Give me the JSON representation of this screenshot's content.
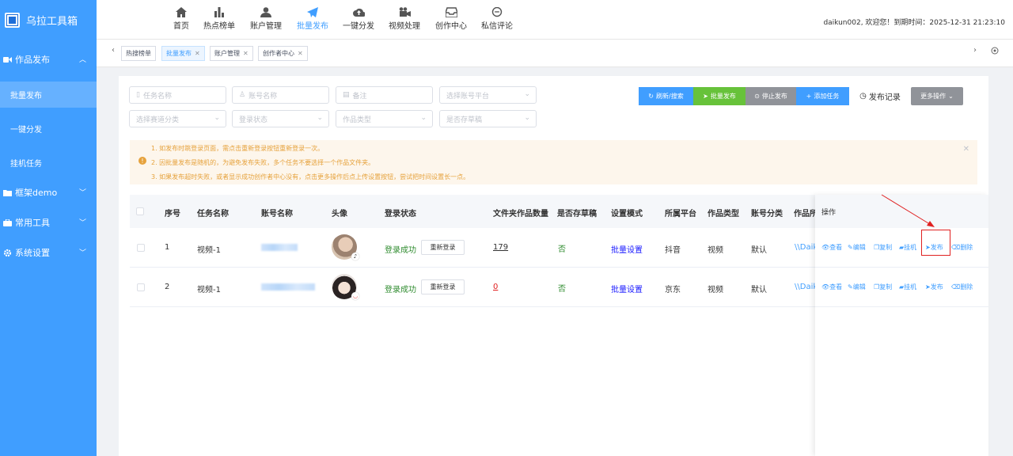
{
  "app": {
    "title": "乌拉工具箱"
  },
  "sidebar": {
    "groups": [
      {
        "label": "作品发布",
        "icon": "video-camera-icon"
      },
      {
        "label": "框架demo",
        "icon": "folder-icon"
      },
      {
        "label": "常用工具",
        "icon": "briefcase-icon"
      },
      {
        "label": "系统设置",
        "icon": "gear-icon"
      }
    ],
    "subitems": [
      "批量发布",
      "一键分发",
      "挂机任务"
    ]
  },
  "topnav": {
    "items": [
      "首页",
      "热点榜单",
      "账户管理",
      "批量发布",
      "一键分发",
      "视频处理",
      "创作中心",
      "私信评论"
    ],
    "active": "批量发布",
    "user_info": "daikun002, 欢迎您！到期时间：2025-12-31 21:23:10"
  },
  "tabs": [
    {
      "label": "热搜榜单"
    },
    {
      "label": "批量发布"
    },
    {
      "label": "账户管理"
    },
    {
      "label": "创作者中心"
    }
  ],
  "filters": {
    "task_name": "任务名称",
    "account_name": "账号名称",
    "remark": "备注",
    "platform": "选择账号平台",
    "category": "选择赛道分类",
    "login_status": "登录状态",
    "work_type": "作品类型",
    "draft": "是否存草稿"
  },
  "toolbar": {
    "refresh": "刷新/搜索",
    "batch_publish": "批量发布",
    "stop_publish": "停止发布",
    "add_task": "添加任务",
    "publish_log": "发布记录",
    "more": "更多操作"
  },
  "alert": {
    "lines": [
      "1. 如发布时跳登录页面，需点击重新登录按钮重新登录一次。",
      "2. 因批量发布是随机的，为避免发布失败，多个任务不要选择一个作品文件夹。",
      "3. 如果发布超时失败，或者显示成功创作者中心没有，点击更多操作后点上传设置按钮，尝试把时间设置长一点。"
    ]
  },
  "table": {
    "headers": [
      "序号",
      "任务名称",
      "账号名称",
      "头像",
      "登录状态",
      "文件夹作品数量",
      "是否存草稿",
      "设置模式",
      "所属平台",
      "作品类型",
      "账号分类",
      "作品所",
      "操作"
    ],
    "relogin_label": "重新登录",
    "rows": [
      {
        "index": "1",
        "task": "视频-1",
        "login": "登录成功",
        "count": "179",
        "draft": "否",
        "mode": "批量设置",
        "platform": "抖音",
        "type": "视频",
        "category": "默认",
        "path": "\\\\Daik",
        "count_color": "#333333"
      },
      {
        "index": "2",
        "task": "视频-1",
        "login": "登录成功",
        "count": "0",
        "draft": "否",
        "mode": "批量设置",
        "platform": "京东",
        "type": "视频",
        "category": "默认",
        "path": "\\\\Daik",
        "count_color": "#e02020"
      }
    ],
    "ops": [
      "查看",
      "编辑",
      "复制",
      "挂机",
      "发布",
      "删除"
    ]
  },
  "colors": {
    "primary": "#409eff",
    "success": "#67c23a",
    "warning": "#e6a23c",
    "danger": "#e02020"
  }
}
